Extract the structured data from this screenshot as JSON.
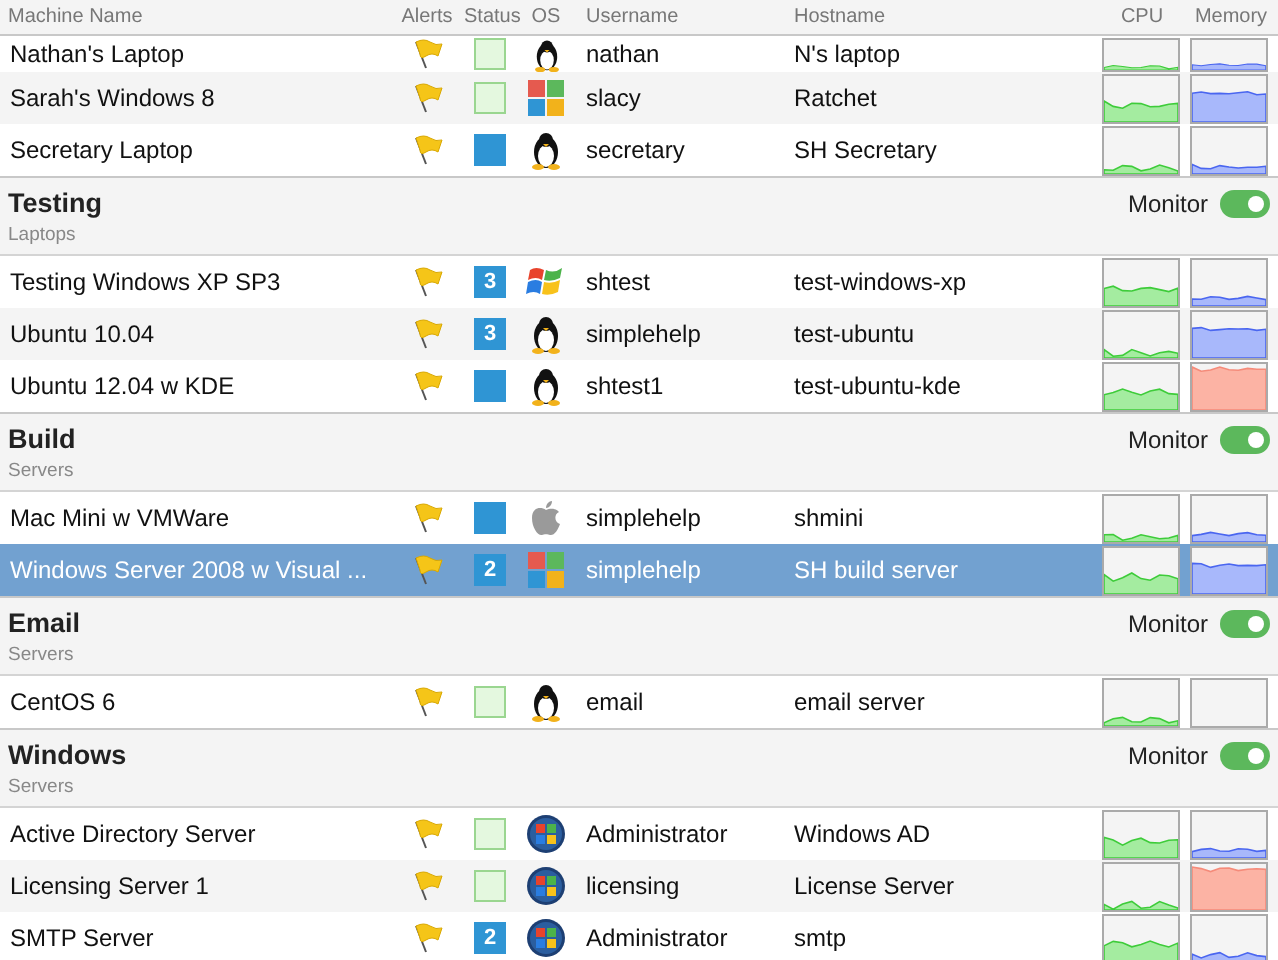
{
  "columns": [
    "Machine Name",
    "Alerts",
    "Status",
    "OS",
    "Username",
    "Hostname",
    "CPU",
    "Memory"
  ],
  "groups": [
    {
      "machines": [
        {
          "name": "Nathan's Laptop",
          "status": {
            "kind": "idle"
          },
          "os": {
            "kind": "linux"
          },
          "username": "nathan",
          "hostname": "N's laptop",
          "memory": {
            "kind": "normal"
          },
          "selected": false
        },
        {
          "name": "Sarah's Windows 8",
          "status": {
            "kind": "idle"
          },
          "os": {
            "kind": "windows8"
          },
          "username": "slacy",
          "hostname": "Ratchet",
          "memory": {
            "kind": "normal"
          },
          "selected": false
        },
        {
          "name": "Secretary Laptop",
          "status": {
            "kind": "active"
          },
          "os": {
            "kind": "linux"
          },
          "username": "secretary",
          "hostname": "SH Secretary",
          "memory": {
            "kind": "normal"
          },
          "selected": false
        }
      ]
    },
    {
      "title": "Testing",
      "subtitle": "Laptops",
      "monitor": {
        "label": "Monitor",
        "on": true
      },
      "machines": [
        {
          "name": "Testing Windows XP SP3",
          "status": {
            "kind": "count",
            "count": "3"
          },
          "os": {
            "kind": "windowsxp"
          },
          "username": "shtest",
          "hostname": "test-windows-xp",
          "memory": {
            "kind": "normal"
          },
          "selected": false
        },
        {
          "name": "Ubuntu 10.04",
          "status": {
            "kind": "count",
            "count": "3"
          },
          "os": {
            "kind": "linux"
          },
          "username": "simplehelp",
          "hostname": "test-ubuntu",
          "memory": {
            "kind": "normal"
          },
          "selected": false
        },
        {
          "name": "Ubuntu 12.04 w KDE",
          "status": {
            "kind": "active"
          },
          "os": {
            "kind": "linux"
          },
          "username": "shtest1",
          "hostname": "test-ubuntu-kde",
          "memory": {
            "kind": "high"
          },
          "selected": false
        }
      ]
    },
    {
      "title": "Build",
      "subtitle": "Servers",
      "monitor": {
        "label": "Monitor",
        "on": true
      },
      "machines": [
        {
          "name": "Mac Mini w VMWare",
          "status": {
            "kind": "active"
          },
          "os": {
            "kind": "apple"
          },
          "username": "simplehelp",
          "hostname": "shmini",
          "memory": {
            "kind": "normal"
          },
          "selected": false
        },
        {
          "name": "Windows Server 2008 w Visual ...",
          "status": {
            "kind": "count",
            "count": "2"
          },
          "os": {
            "kind": "windows8"
          },
          "username": "simplehelp",
          "hostname": "SH build server",
          "memory": {
            "kind": "normal"
          },
          "selected": true
        }
      ]
    },
    {
      "title": "Email",
      "subtitle": "Servers",
      "monitor": {
        "label": "Monitor",
        "on": true
      },
      "machines": [
        {
          "name": "CentOS 6",
          "status": {
            "kind": "idle"
          },
          "os": {
            "kind": "linux"
          },
          "username": "email",
          "hostname": "email server",
          "memory": {
            "kind": "empty"
          },
          "selected": false
        }
      ]
    },
    {
      "title": "Windows",
      "subtitle": "Servers",
      "monitor": {
        "label": "Monitor",
        "on": true
      },
      "machines": [
        {
          "name": "Active Directory Server",
          "status": {
            "kind": "idle"
          },
          "os": {
            "kind": "windows7"
          },
          "username": "Administrator",
          "hostname": "Windows AD",
          "memory": {
            "kind": "normal"
          },
          "selected": false
        },
        {
          "name": "Licensing Server 1",
          "status": {
            "kind": "idle"
          },
          "os": {
            "kind": "windows7"
          },
          "username": "licensing",
          "hostname": "License Server",
          "memory": {
            "kind": "high"
          },
          "selected": false
        },
        {
          "name": "SMTP Server",
          "status": {
            "kind": "count",
            "count": "2"
          },
          "os": {
            "kind": "windows7"
          },
          "username": "Administrator",
          "hostname": "smtp",
          "memory": {
            "kind": "normal"
          },
          "selected": false
        }
      ]
    }
  ]
}
